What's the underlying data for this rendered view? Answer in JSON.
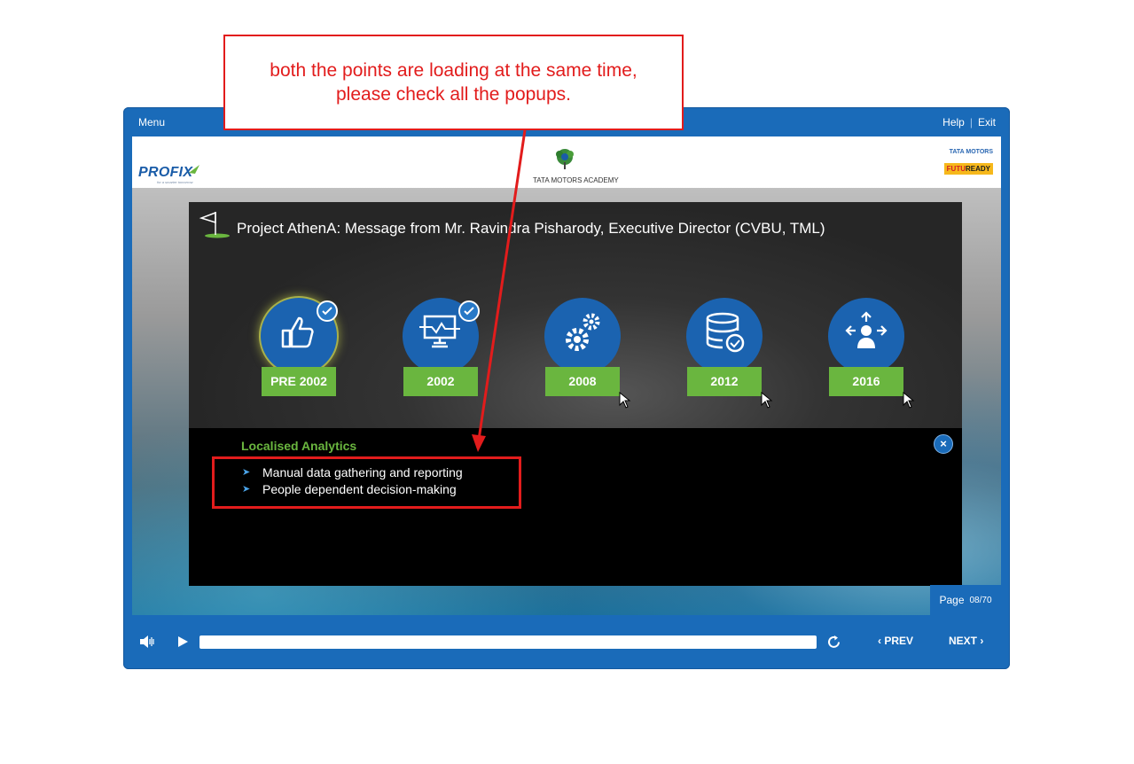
{
  "topbar": {
    "menu": "Menu",
    "help": "Help",
    "separator": "|",
    "exit": "Exit"
  },
  "header": {
    "profix_logo": "PROFIX",
    "profix_tagline": "for a smarter tomorrow",
    "academy_label": "TATA MOTORS ACADEMY",
    "tata_motors": "TATA MOTORS",
    "futuready_a": "FUTU",
    "futuready_b": "READY"
  },
  "slide": {
    "title": "Project AthenA: Message from Mr. Ravindra Pisharody, Executive Director (CVBU, TML)",
    "milestones": [
      {
        "label": "PRE 2002",
        "icon": "thumbs-up-icon",
        "visited": true
      },
      {
        "label": "2002",
        "icon": "monitor-chart-icon",
        "visited": true
      },
      {
        "label": "2008",
        "icon": "gears-icon",
        "visited": false
      },
      {
        "label": "2012",
        "icon": "database-check-icon",
        "visited": false
      },
      {
        "label": "2016",
        "icon": "person-arrows-icon",
        "visited": false
      }
    ]
  },
  "popup": {
    "title": "Localised Analytics",
    "close": "×",
    "bullets": [
      "Manual data gathering and reporting",
      "People dependent decision-making"
    ]
  },
  "pagination": {
    "label": "Page",
    "value": "08/70"
  },
  "controls": {
    "prev": "PREV",
    "next": "NEXT"
  },
  "annotation": {
    "line1": "both the points are loading at the same time,",
    "line2": "please check all the popups."
  },
  "colors": {
    "shell": "#1a6bb9",
    "year_button": "#6ab63f",
    "annotation": "#e21c1c"
  }
}
